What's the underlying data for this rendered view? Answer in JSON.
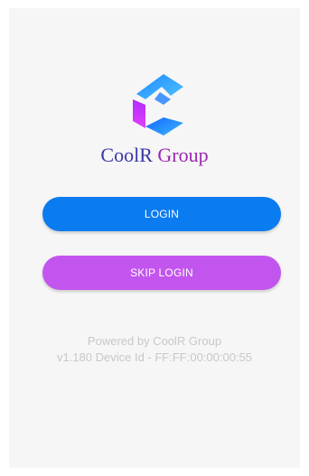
{
  "brand": {
    "name_part1": "CoolR",
    "name_part2": "Group",
    "logo_icon": "coolr-c-logo-icon"
  },
  "colors": {
    "login_button": "#0b7bf0",
    "skip_button": "#c355ef",
    "brand_blue": "#3a36a8",
    "brand_purple": "#9c27b0",
    "footer_text": "#c8c8c8"
  },
  "actions": {
    "login_label": "LOGIN",
    "skip_label": "SKIP LOGIN"
  },
  "footer": {
    "powered_by": "Powered by CoolR Group",
    "version_line": "v1.180  Device Id - FF:FF:00:00:00:55"
  }
}
